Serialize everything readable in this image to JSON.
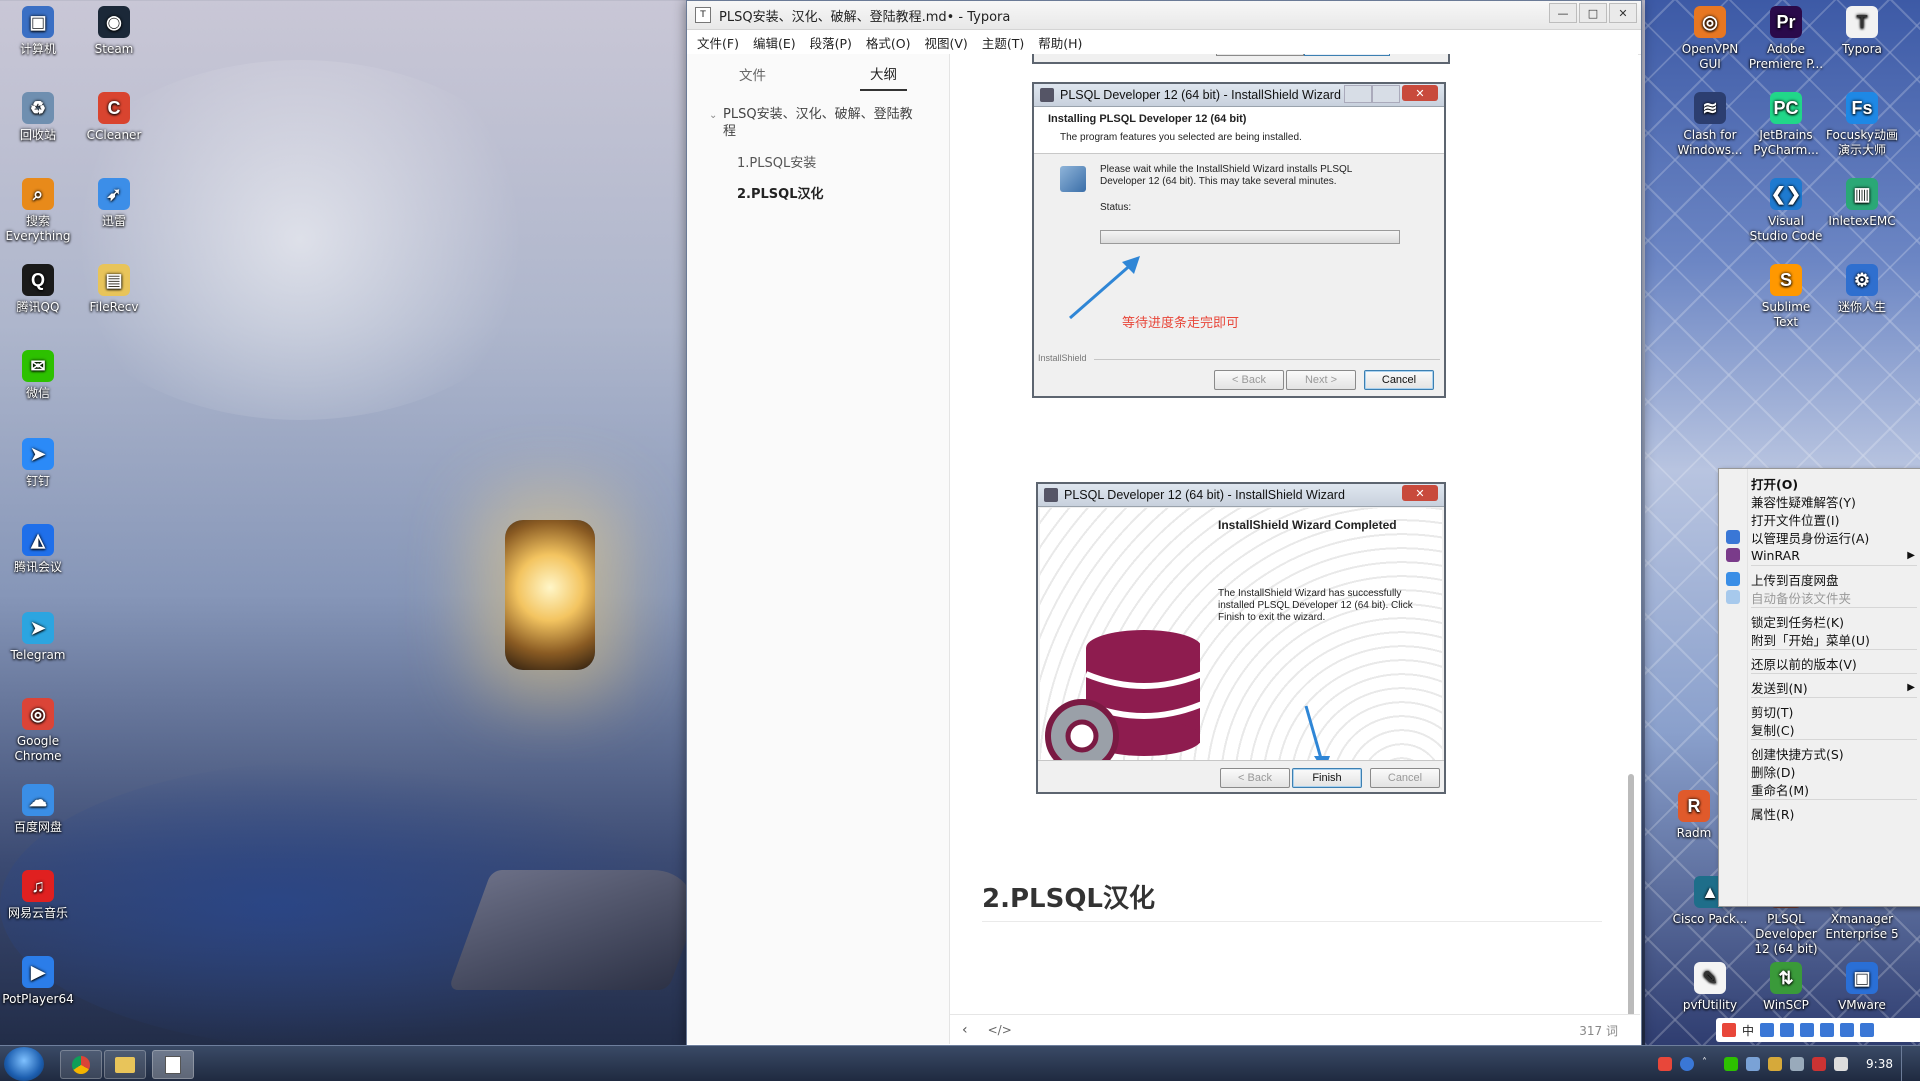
{
  "desktop_left": [
    {
      "label": "计算机",
      "color": "#3a6fc4",
      "glyph": "▣",
      "icon": "computer-icon"
    },
    {
      "label": "Steam",
      "color": "#1b2838",
      "glyph": "◉",
      "icon": "steam-icon"
    },
    {
      "label": "回收站",
      "color": "#6f8fb0",
      "glyph": "♻",
      "icon": "recycle-bin-icon"
    },
    {
      "label": "CCleaner",
      "color": "#d9442f",
      "glyph": "C",
      "icon": "ccleaner-icon"
    },
    {
      "label": "搜索Everything",
      "color": "#e88a1a",
      "glyph": "⌕",
      "icon": "everything-search-icon"
    },
    {
      "label": "迅雷",
      "color": "#3c8ee8",
      "glyph": "➶",
      "icon": "xunlei-icon"
    },
    {
      "label": "腾讯QQ",
      "color": "#1a1a1a",
      "glyph": "Q",
      "icon": "qq-icon"
    },
    {
      "label": "FileRecv",
      "color": "#e8c45a",
      "glyph": "▤",
      "icon": "folder-icon"
    },
    {
      "label": "微信",
      "color": "#2dc100",
      "glyph": "✉",
      "icon": "wechat-icon"
    },
    {
      "label": "钉钉",
      "color": "#2b8af7",
      "glyph": "➤",
      "icon": "dingtalk-icon"
    },
    {
      "label": "腾讯会议",
      "color": "#1f6fea",
      "glyph": "◭",
      "icon": "tencent-meeting-icon"
    },
    {
      "label": "Telegram",
      "color": "#2ca5e0",
      "glyph": "➤",
      "icon": "telegram-icon"
    },
    {
      "label": "Google Chrome",
      "color": "#db4437",
      "glyph": "◎",
      "icon": "chrome-icon"
    },
    {
      "label": "百度网盘",
      "color": "#3a8ee6",
      "glyph": "☁",
      "icon": "baidu-netdisk-icon"
    },
    {
      "label": "网易云音乐",
      "color": "#e02020",
      "glyph": "♫",
      "icon": "netease-music-icon"
    },
    {
      "label": "PotPlayer64",
      "color": "#2b7de9",
      "glyph": "▶",
      "icon": "potplayer-icon"
    }
  ],
  "desktop_right": [
    {
      "label": "OpenVPN GUI",
      "color": "#e87722",
      "glyph": "◎",
      "icon": "openvpn-icon"
    },
    {
      "label": "Adobe Premiere P...",
      "color": "#2a0a4a",
      "glyph": "Pr",
      "icon": "premiere-icon"
    },
    {
      "label": "Typora",
      "color": "#f2f2f2",
      "glyph": "T",
      "icon": "typora-icon"
    },
    {
      "label": "Clash for Windows...",
      "color": "#2c3e70",
      "glyph": "≋",
      "icon": "clash-icon"
    },
    {
      "label": "JetBrains PyCharm...",
      "color": "#21d789",
      "glyph": "PC",
      "icon": "pycharm-icon"
    },
    {
      "label": "Focusky动画演示大师",
      "color": "#1e88e5",
      "glyph": "Fs",
      "icon": "focusky-icon"
    },
    {
      "label": "Visual Studio Code",
      "color": "#1e7ad0",
      "glyph": "❮❯",
      "icon": "vscode-icon"
    },
    {
      "label": "InletexEMC",
      "color": "#2aa876",
      "glyph": "▥",
      "icon": "inletex-icon"
    },
    {
      "label": "Sublime Text",
      "color": "#ff9800",
      "glyph": "S",
      "icon": "sublime-icon"
    },
    {
      "label": "迷你人生",
      "color": "#2f6fcf",
      "glyph": "⚙",
      "icon": "app-icon"
    },
    {
      "label": "Radm",
      "color": "#e05a2b",
      "glyph": "R",
      "icon": "radmin-icon"
    },
    {
      "label": "Cisco Pack...",
      "color": "#1e6e8a",
      "glyph": "▲",
      "icon": "cisco-icon"
    },
    {
      "label": "PLSQL Developer 12 (64 bit)",
      "color": "#7a3b2e",
      "glyph": "▦",
      "icon": "plsql-icon"
    },
    {
      "label": "Xmanager Enterprise 5",
      "color": "#4b6fb0",
      "glyph": "X",
      "icon": "xmanager-icon"
    },
    {
      "label": "pvfUtility",
      "color": "#f4f4f4",
      "glyph": "✎",
      "icon": "pvfutility-icon"
    },
    {
      "label": "WinSCP",
      "color": "#3a9a3a",
      "glyph": "⇅",
      "icon": "winscp-icon"
    },
    {
      "label": "VMware",
      "color": "#2a6fd6",
      "glyph": "▣",
      "icon": "vmware-icon"
    }
  ],
  "typora": {
    "title": "PLSQ安装、汉化、破解、登陆教程.md• - Typora",
    "menu": [
      "文件(F)",
      "编辑(E)",
      "段落(P)",
      "格式(O)",
      "视图(V)",
      "主题(T)",
      "帮助(H)"
    ],
    "tabs": {
      "files": "文件",
      "outline": "大纲"
    },
    "outline": {
      "h1": "PLSQ安装、汉化、破解、登陆教程",
      "h2": [
        "1.PLSQL安装",
        "2.PLSQL汉化"
      ]
    },
    "heading": "2.PLSQL汉化",
    "word_count": "317 词",
    "code_toggle": "</>"
  },
  "wizard_installing": {
    "title": "PLSQL Developer 12 (64 bit) - InstallShield Wizard",
    "heading": "Installing PLSQL Developer 12 (64 bit)",
    "subheading": "The program features you selected are being installed.",
    "body": "Please wait while the InstallShield Wizard installs PLSQL Developer 12 (64 bit). This may take several minutes.",
    "status_label": "Status:",
    "annotation": "等待进度条走完即可",
    "brand": "InstallShield",
    "back": "< Back",
    "next": "Next >",
    "cancel": "Cancel",
    "progress": 0.0
  },
  "wizard_completed": {
    "title": "PLSQL Developer 12 (64 bit) - InstallShield Wizard",
    "heading": "InstallShield Wizard Completed",
    "body": "The InstallShield Wizard has successfully installed PLSQL Developer 12 (64 bit). Click Finish to exit the wizard.",
    "back": "< Back",
    "finish": "Finish",
    "cancel": "Cancel"
  },
  "context_menu": [
    {
      "label": "打开(O)",
      "bold": true
    },
    {
      "label": "兼容性疑难解答(Y)"
    },
    {
      "label": "打开文件位置(I)"
    },
    {
      "label": "以管理员身份运行(A)",
      "icon": "shield-icon"
    },
    {
      "label": "WinRAR",
      "icon": "winrar-icon",
      "submenu": true
    },
    {
      "sep": true
    },
    {
      "label": "上传到百度网盘",
      "icon": "baidu-netdisk-icon"
    },
    {
      "label": "自动备份该文件夹",
      "icon": "baidu-netdisk-icon",
      "disabled": true
    },
    {
      "sep": true
    },
    {
      "label": "锁定到任务栏(K)"
    },
    {
      "label": "附到「开始」菜单(U)"
    },
    {
      "sep": true
    },
    {
      "label": "还原以前的版本(V)"
    },
    {
      "sep": true
    },
    {
      "label": "发送到(N)",
      "submenu": true
    },
    {
      "sep": true
    },
    {
      "label": "剪切(T)"
    },
    {
      "label": "复制(C)"
    },
    {
      "sep": true
    },
    {
      "label": "创建快捷方式(S)"
    },
    {
      "label": "删除(D)"
    },
    {
      "label": "重命名(M)"
    },
    {
      "sep": true
    },
    {
      "label": "属性(R)"
    }
  ],
  "taskbar": {
    "clock": "9:38",
    "ime_label": "中"
  },
  "colors": {
    "accent": "#3c7fb1",
    "annotation_red": "#e8473a",
    "arrow_blue": "#2f86d6",
    "db_maroon": "#8e1c4f"
  }
}
